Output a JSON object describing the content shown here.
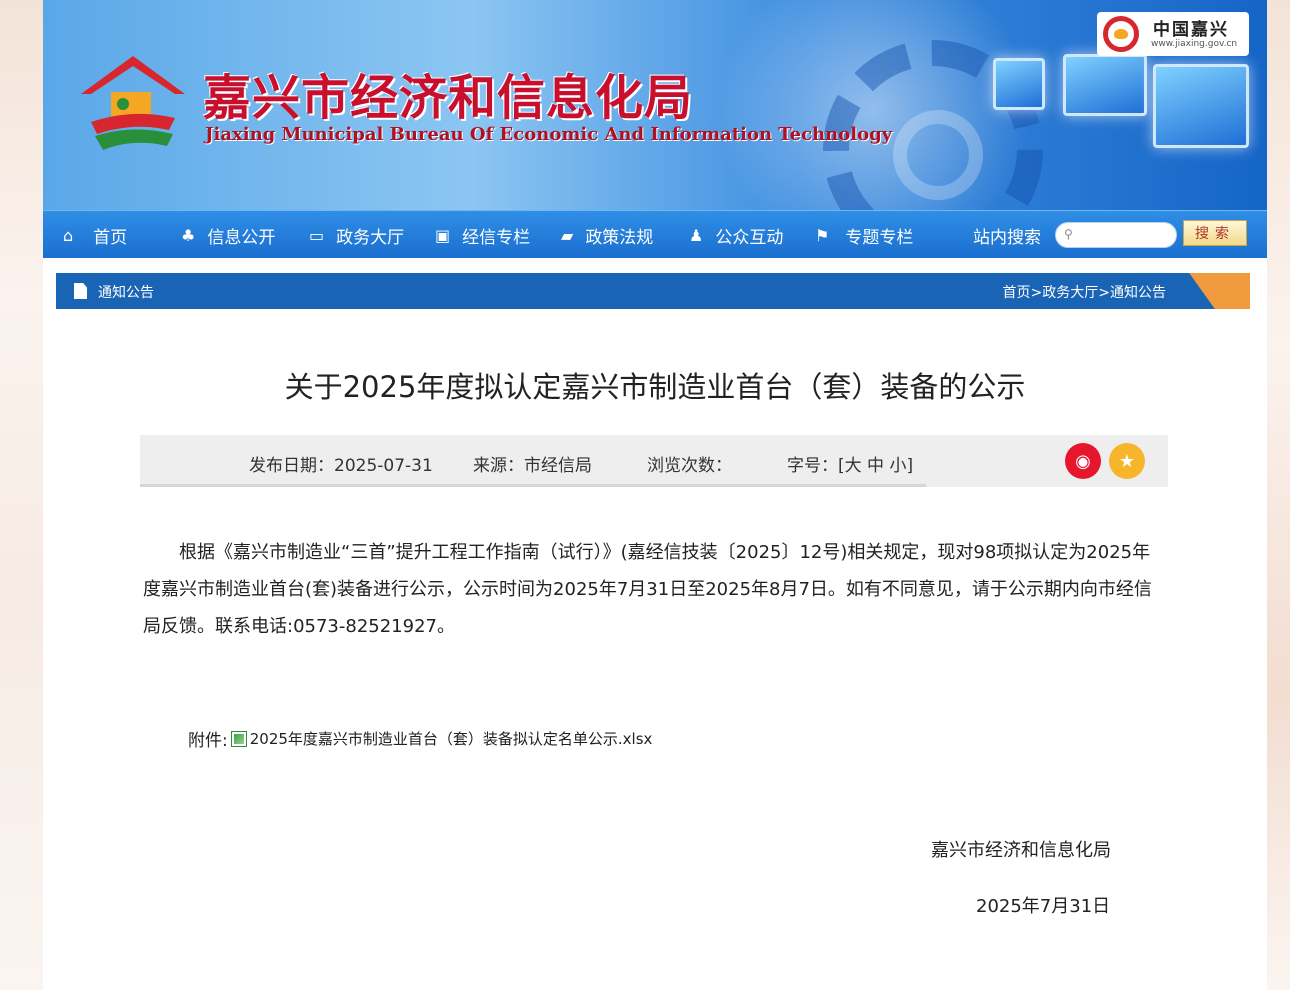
{
  "header": {
    "title": "嘉兴市经济和信息化局",
    "subtitle": "Jiaxing Municipal Bureau Of Economic And Information Technology",
    "portal_name": "中国嘉兴",
    "portal_url": "www.jiaxing.gov.cn"
  },
  "nav": {
    "items": [
      {
        "label": "首页",
        "icon": "home-icon"
      },
      {
        "label": "信息公开",
        "icon": "sitemap-icon"
      },
      {
        "label": "政务大厅",
        "icon": "monitor-icon"
      },
      {
        "label": "经信专栏",
        "icon": "briefcase-icon"
      },
      {
        "label": "政策法规",
        "icon": "folder-icon"
      },
      {
        "label": "公众互动",
        "icon": "user-icon"
      },
      {
        "label": "专题专栏",
        "icon": "flag-icon"
      }
    ],
    "search_label": "站内搜索",
    "search_placeholder": "",
    "search_button": "搜索"
  },
  "section": {
    "label": "通知公告",
    "breadcrumb": "首页>政务大厅>通知公告"
  },
  "article": {
    "title": "关于2025年度拟认定嘉兴市制造业首台（套）装备的公示",
    "publish_date": "发布日期：2025-07-31",
    "source": "来源：市经信局",
    "views": "浏览次数：",
    "font_size": "字号：[大 中 小]",
    "body": "根据《嘉兴市制造业“三首”提升工程工作指南（试行）》(嘉经信技装〔2025〕12号)相关规定，现对98项拟认定为2025年度嘉兴市制造业首台(套)装备进行公示，公示时间为2025年7月31日至2025年8月7日。如有不同意见，请于公示期内向市经信局反馈。联系电话:0573-82521927。",
    "attachment_label": "附件:",
    "attachment_file": "2025年度嘉兴市制造业首台（套）装备拟认定名单公示.xlsx",
    "sign_org": "嘉兴市经济和信息化局",
    "sign_date": "2025年7月31日"
  },
  "colors": {
    "nav_blue": "#1b6fcf",
    "section_blue": "#1964b5",
    "title_red": "#c8102e",
    "weibo_red": "#e6162d",
    "favorite_orange": "#f7b52c"
  }
}
